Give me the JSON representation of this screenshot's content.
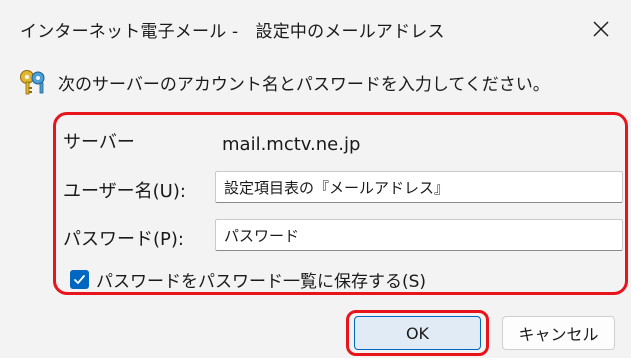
{
  "dialog": {
    "title": "インターネット電子メール -　設定中のメールアドレス",
    "message": "次のサーバーのアカウント名とパスワードを入力してください。"
  },
  "fields": {
    "server_label": "サーバー",
    "server_value": "mail.mctv.ne.jp",
    "username_label": "ユーザー名(U):",
    "username_value": "設定項目表の『メールアドレス』",
    "password_label": "パスワード(P):",
    "password_value": "パスワード"
  },
  "save_password": {
    "label": "パスワードをパスワード一覧に保存する(S)",
    "checked": true
  },
  "buttons": {
    "ok_label": "OK",
    "cancel_label": "キャンセル"
  },
  "colors": {
    "accent": "#0067c0",
    "highlight": "#e8141c"
  },
  "icons": {
    "message": "keys-icon",
    "close": "close-icon",
    "checkbox": "checkmark-icon"
  }
}
